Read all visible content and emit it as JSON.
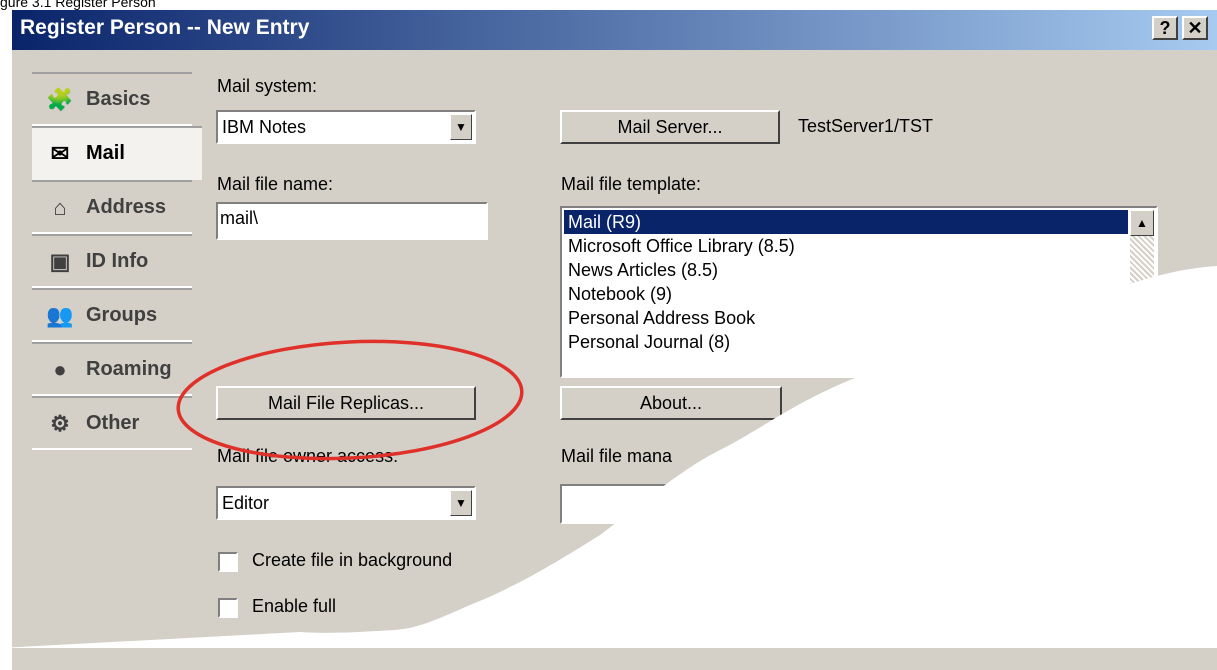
{
  "caption": "gure 3.1 Register Person",
  "window": {
    "title": "Register Person -- New Entry",
    "help_glyph": "?",
    "close_glyph": "✕"
  },
  "nav": {
    "items": [
      {
        "label": "Basics",
        "icon": "basics-icon",
        "glyph": "🧩"
      },
      {
        "label": "Mail",
        "icon": "mail-icon",
        "glyph": "✉"
      },
      {
        "label": "Address",
        "icon": "house-icon",
        "glyph": "⌂"
      },
      {
        "label": "ID Info",
        "icon": "id-card-icon",
        "glyph": "▣"
      },
      {
        "label": "Groups",
        "icon": "people-icon",
        "glyph": "👥"
      },
      {
        "label": "Roaming",
        "icon": "globe-icon",
        "glyph": "●"
      },
      {
        "label": "Other",
        "icon": "other-icon",
        "glyph": "⚙"
      }
    ],
    "active": "Mail"
  },
  "mail": {
    "system_label": "Mail system:",
    "system_value": "IBM Notes",
    "server_button": "Mail Server...",
    "server_value": "TestServer1/TST",
    "file_name_label": "Mail file name:",
    "file_name_value": "mail\\",
    "template_label": "Mail file template:",
    "templates": [
      "Mail (R9)",
      "Microsoft Office Library (8.5)",
      "News Articles (8.5)",
      "Notebook (9)",
      "Personal Address Book",
      "Personal Journal (8)"
    ],
    "selected_template": "Mail (R9)",
    "replicas_button": "Mail File Replicas...",
    "about_button": "About...",
    "owner_access_label": "Mail file owner access:",
    "owner_access_value": "Editor",
    "manager_label": "Mail file mana",
    "create_background_label": "Create file in background",
    "enable_full_label": "Enable full",
    "arrow_glyph": "▼",
    "scroll_up_glyph": "▲"
  },
  "colors": {
    "titlebar": "#0a246a",
    "dialog": "#d4d0c8",
    "selection": "#0a246a",
    "annotation": "#e0302a"
  }
}
